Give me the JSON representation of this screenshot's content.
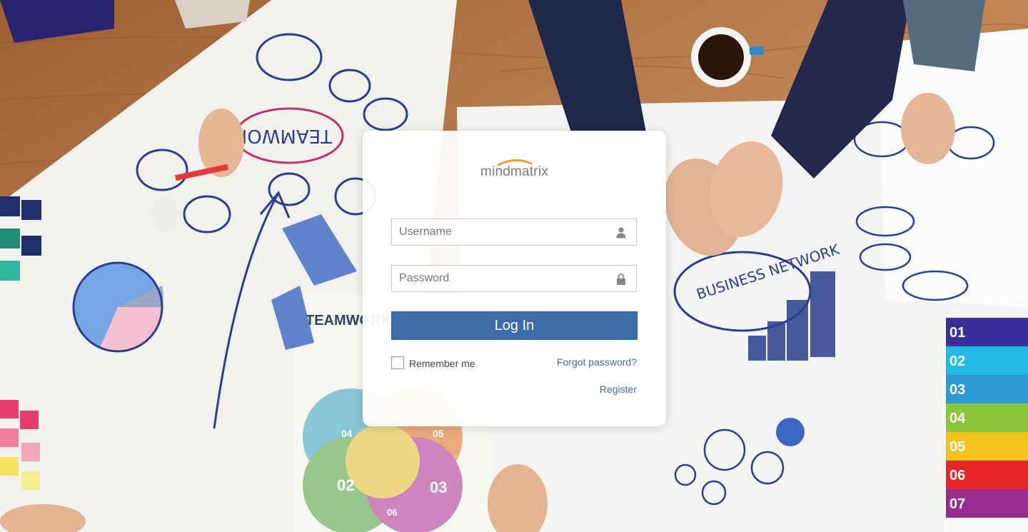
{
  "brand": {
    "name": "mindmatrix",
    "arc_color": "#f0a030",
    "text_color": "#7b7b7b"
  },
  "login": {
    "username_placeholder": "Username",
    "username_value": "",
    "username_icon": "user-icon",
    "password_placeholder": "Password",
    "password_value": "",
    "password_icon": "lock-icon",
    "submit_label": "Log In",
    "remember_label": "Remember me",
    "remember_checked": false,
    "forgot_label": "Forgot password?",
    "register_label": "Register"
  },
  "colors": {
    "primary": "#3d6da9",
    "link": "#3d6da9"
  },
  "background": {
    "teamwork_label": "TEAMWORK",
    "business_network_label": "BUSINESS NETWORK",
    "legend_steps": [
      "01",
      "02",
      "03",
      "04",
      "05",
      "06",
      "07"
    ],
    "venn_labels": [
      "02",
      "03",
      "04",
      "05",
      "06"
    ]
  }
}
